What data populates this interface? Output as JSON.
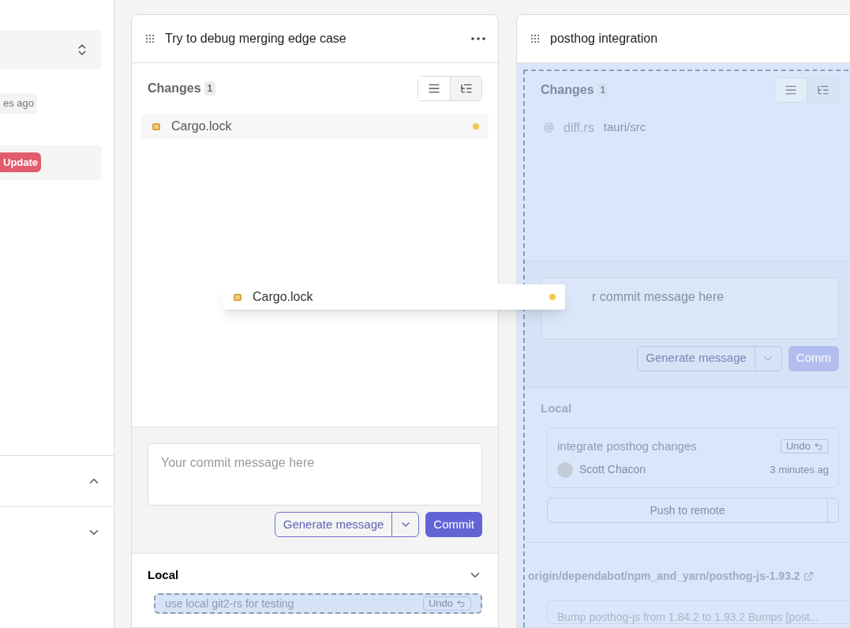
{
  "sidebar": {
    "time_badge": "es ago",
    "status_badge": "Update",
    "sections": [
      {
        "expanded": true
      },
      {
        "expanded": false
      }
    ]
  },
  "lanes": [
    {
      "title": "Try to debug merging edge case",
      "drop_target": false,
      "changes": {
        "label": "Changes",
        "count": "1",
        "view_modes": [
          {
            "kind": "list",
            "selected": true
          },
          {
            "kind": "tree",
            "selected": false
          }
        ],
        "files": [
          {
            "name": "Cargo.lock",
            "color": "#f2c94c"
          }
        ]
      },
      "commit": {
        "placeholder": "Your commit message here",
        "generate_label": "Generate message",
        "commit_label": "Commit"
      },
      "local": {
        "title": "Local",
        "expanded": false,
        "commits": [
          {
            "message": "use local git2-rs for testing",
            "undo": "Undo",
            "drop_target": true
          }
        ]
      }
    },
    {
      "title": "posthog integration",
      "drop_target": true,
      "changes": {
        "label": "Changes",
        "count": "1",
        "view_modes": [
          {
            "kind": "list",
            "selected": true
          },
          {
            "kind": "tree",
            "selected": false
          }
        ],
        "files": [
          {
            "name": "diff.rs",
            "path": "tauri/src"
          }
        ]
      },
      "commit": {
        "placeholder": "r commit message here",
        "generate_label": "Generate message",
        "commit_label": "Comm"
      },
      "local": {
        "title": "Local",
        "commits": [
          {
            "message": "integrate posthog changes",
            "undo": "Undo",
            "author": "Scott Chacon",
            "time": "3 minutes ag",
            "drop_target": false
          }
        ],
        "push_label": "Push to remote"
      },
      "remote": {
        "branch": "origin/dependabot/npm_and_yarn/posthog-js-1.93.2",
        "commits": [
          {
            "message": "Bump posthog-js from 1.84.2 to 1.93.2 Bumps [post..."
          }
        ]
      }
    }
  ],
  "drag_preview": {
    "name": "Cargo.lock",
    "color": "#f2c94c"
  }
}
